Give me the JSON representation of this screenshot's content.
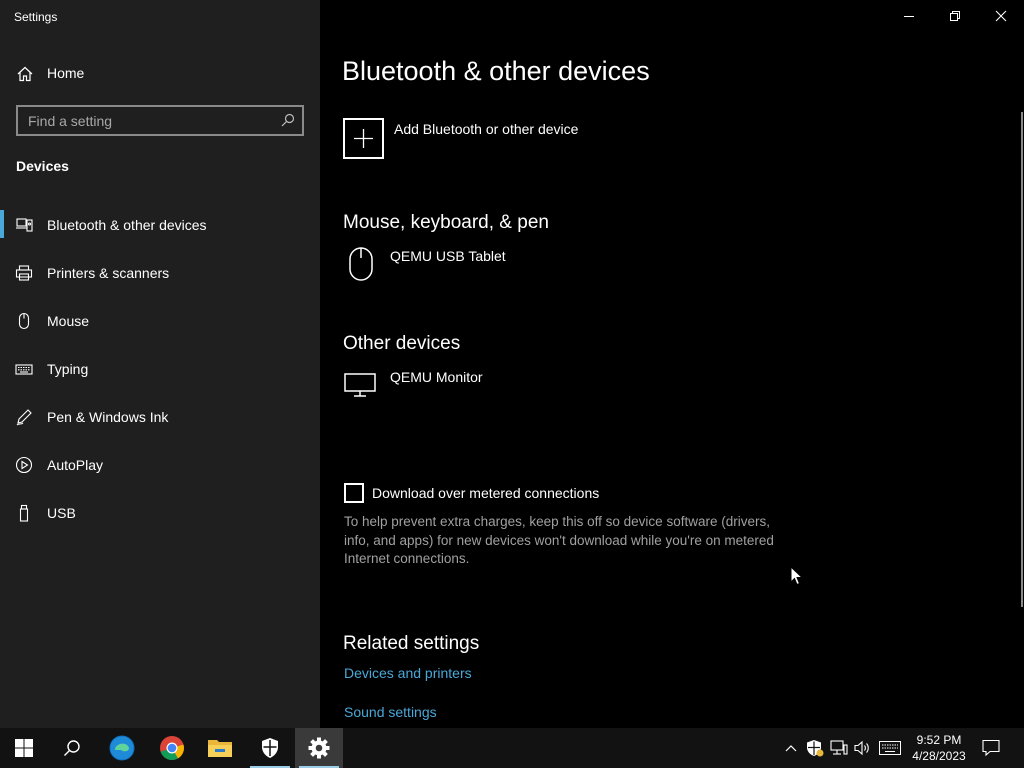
{
  "window": {
    "title": "Settings"
  },
  "sidebar": {
    "home_label": "Home",
    "search_placeholder": "Find a setting",
    "section_label": "Devices",
    "items": [
      {
        "label": "Bluetooth & other devices",
        "icon": "bluetooth-devices-icon",
        "active": true
      },
      {
        "label": "Printers & scanners",
        "icon": "printer-icon"
      },
      {
        "label": "Mouse",
        "icon": "mouse-icon"
      },
      {
        "label": "Typing",
        "icon": "keyboard-icon"
      },
      {
        "label": "Pen & Windows Ink",
        "icon": "pen-icon"
      },
      {
        "label": "AutoPlay",
        "icon": "autoplay-icon"
      },
      {
        "label": "USB",
        "icon": "usb-icon"
      }
    ]
  },
  "main": {
    "title": "Bluetooth & other devices",
    "add_device_label": "Add Bluetooth or other device",
    "groups": [
      {
        "title": "Mouse, keyboard, & pen",
        "devices": [
          {
            "name": "QEMU USB Tablet",
            "icon": "mouse-icon"
          }
        ]
      },
      {
        "title": "Other devices",
        "devices": [
          {
            "name": "QEMU Monitor",
            "icon": "monitor-icon"
          }
        ]
      }
    ],
    "metered": {
      "label": "Download over metered connections",
      "checked": false,
      "help": "To help prevent extra charges, keep this off so device software (drivers, info, and apps) for new devices won't download while you're on metered Internet connections."
    },
    "related": {
      "title": "Related settings",
      "links": [
        "Devices and printers",
        "Sound settings"
      ]
    }
  },
  "taskbar": {
    "time": "9:52 PM",
    "date": "4/28/2023",
    "apps": [
      "start-icon",
      "search-icon",
      "edge-icon",
      "chrome-icon",
      "file-explorer-icon",
      "security-icon",
      "settings-icon"
    ],
    "accent": "#4aa8d8"
  }
}
